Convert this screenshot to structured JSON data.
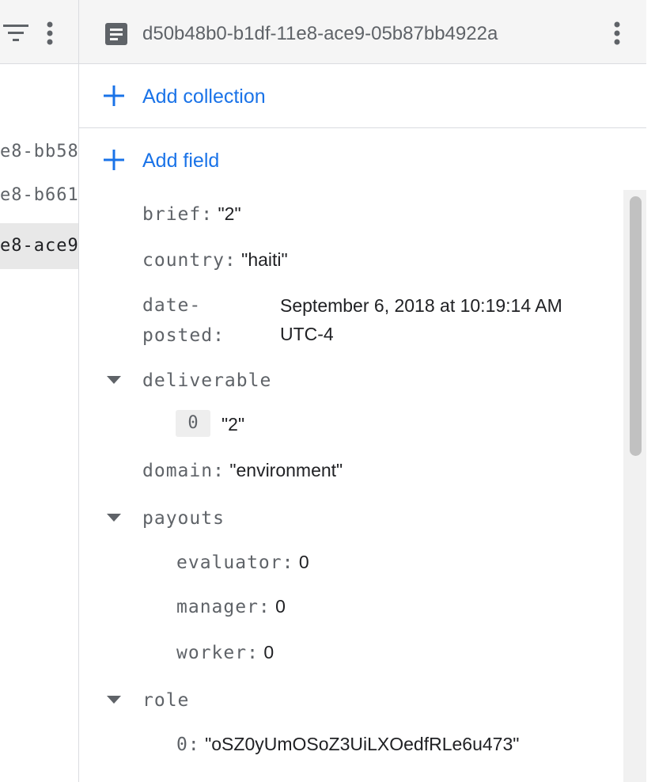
{
  "left_pane": {
    "rows": [
      "e8-bb58",
      "e8-b661",
      "e8-ace9"
    ],
    "selected_index": 2
  },
  "document": {
    "id": "d50b48b0-b1df-11e8-ace9-05b87bb4922a",
    "add_collection_label": "Add collection",
    "add_field_label": "Add field"
  },
  "fields": {
    "brief": {
      "key": "brief:",
      "value": "\"2\""
    },
    "country": {
      "key": "country:",
      "value": "\"haiti\""
    },
    "date_posted": {
      "key_line1": "date-",
      "key_line2": "posted:",
      "value_line1": "September 6, 2018 at 10:19:14 AM",
      "value_line2": "UTC-4"
    },
    "deliverable": {
      "key": "deliverable",
      "items": [
        {
          "index": "0",
          "value": "\"2\""
        }
      ]
    },
    "domain": {
      "key": "domain:",
      "value": "\"environment\""
    },
    "payouts": {
      "key": "payouts",
      "items": [
        {
          "key": "evaluator:",
          "value": "0"
        },
        {
          "key": "manager:",
          "value": "0"
        },
        {
          "key": "worker:",
          "value": "0"
        }
      ]
    },
    "role": {
      "key": "role",
      "items": [
        {
          "key": "0:",
          "value": "\"oSZ0yUmOSoZ3UiLXOedfRLe6u473\""
        }
      ]
    }
  },
  "colors": {
    "accent": "#1a73e8",
    "key_text": "#5f6368",
    "header_bg": "#f5f5f5",
    "divider": "#dadce0"
  },
  "icons": {
    "filter": "filter-icon",
    "more": "more-vert-icon",
    "document": "document-icon",
    "add": "plus-icon",
    "expand": "caret-down-icon"
  }
}
